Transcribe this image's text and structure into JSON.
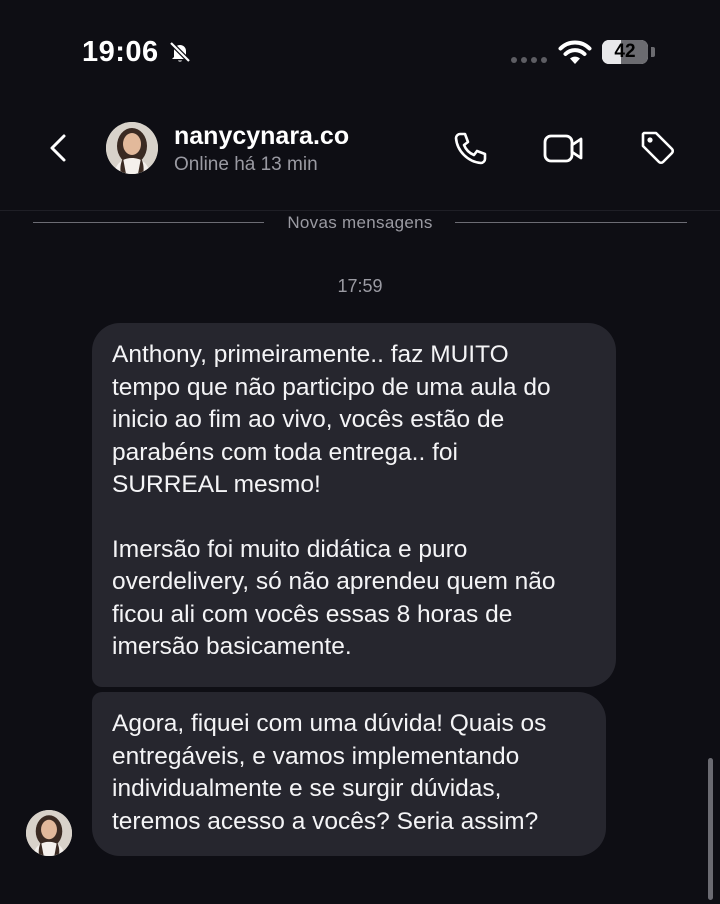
{
  "status_bar": {
    "time": "19:06",
    "battery": "42",
    "battery_level_percent": 42,
    "icons": [
      "bell-slash-icon",
      "signal-icon",
      "wifi-icon",
      "battery-icon"
    ]
  },
  "header": {
    "contact_name": "nanycynara.co",
    "contact_status": "Online há 13 min",
    "icons": [
      "back-chevron-icon",
      "phone-icon",
      "video-icon",
      "tag-icon"
    ]
  },
  "divider": {
    "label": "Novas mensagens"
  },
  "timestamp": "17:59",
  "messages": [
    {
      "paragraph1": "Anthony, primeiramente.. faz MUITO\ntempo que não participo de uma aula do\ninicio ao fim ao vivo, vocês estão de\nparabéns com toda entrega.. foi\nSURREAL mesmo!",
      "paragraph2": "Imersão foi muito didática e puro\noverdelivery, só não aprendeu quem não\nficou ali com vocês essas 8 horas de\nimersão basicamente."
    },
    {
      "paragraph1": "Agora, fiquei com uma dúvida! Quais os\nentregáveis, e vamos implementando\nindividualmente e se surgir dúvidas,\nteremos acesso a vocês? Seria assim?"
    }
  ],
  "colors": {
    "background": "#0e0e14",
    "bubble": "#26262e",
    "secondary_text": "#9a9aa2"
  }
}
